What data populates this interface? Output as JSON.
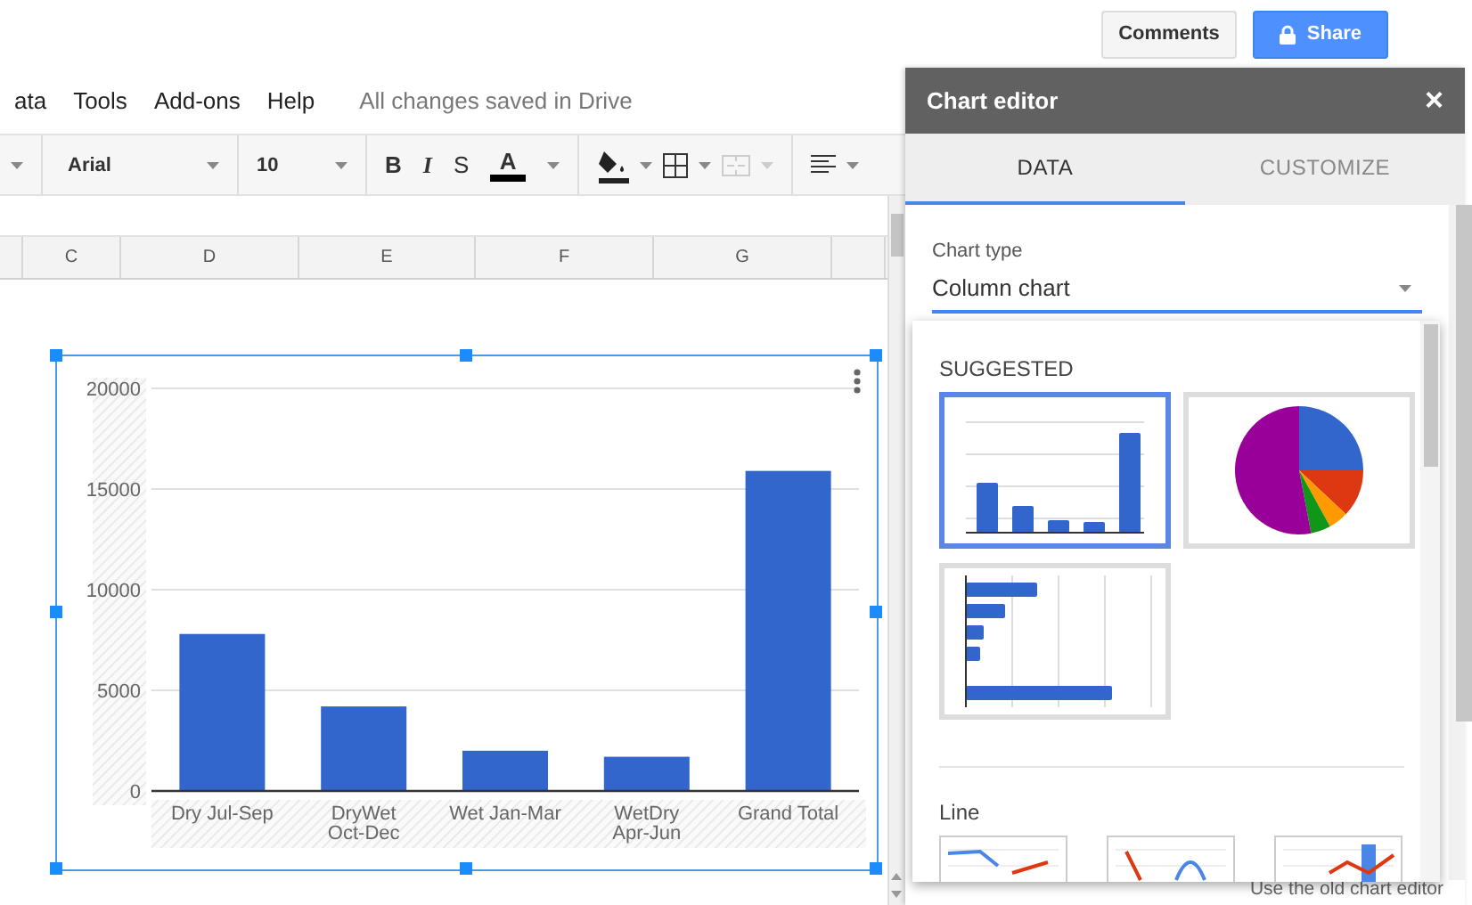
{
  "header": {
    "comments_button": "Comments",
    "share_button": "Share"
  },
  "menu": [
    {
      "label": "ata"
    },
    {
      "label": "Tools"
    },
    {
      "label": "Add-ons"
    },
    {
      "label": "Help"
    }
  ],
  "save_status": "All changes saved in Drive",
  "toolbar": {
    "font": "Arial",
    "font_size": "10",
    "format": [
      {
        "label": "B",
        "kind": "bold"
      },
      {
        "label": "I",
        "kind": "italic"
      },
      {
        "label": "S",
        "kind": "strike"
      },
      {
        "label": "A",
        "kind": "color"
      }
    ]
  },
  "columns": [
    "C",
    "D",
    "E",
    "F",
    "G"
  ],
  "chart": {
    "chart_data": {
      "type": "bar",
      "categories": [
        "Dry Jul-Sep",
        "DryWet Oct-Dec",
        "Wet Jan-Mar",
        "WetDry Apr-Jun",
        "Grand Total"
      ],
      "series": [
        {
          "color": "#3366cc",
          "values": [
            7800,
            4200,
            2000,
            1700,
            15900
          ]
        }
      ],
      "ylim": [
        0,
        20000
      ],
      "grid": true,
      "yticks": [
        0,
        5000,
        10000,
        15000,
        20000
      ]
    }
  },
  "editor": {
    "title": "Chart editor",
    "close": "×",
    "tabs": [
      {
        "label": "DATA",
        "selected": true
      },
      {
        "label": "CUSTOMIZE",
        "selected": false
      }
    ],
    "chart_type_label": "Chart type",
    "chart_type": "Column chart",
    "suggested_heading": "SUGGESTED",
    "suggested": [
      {
        "kind": "column",
        "selected": true
      },
      {
        "kind": "pie",
        "selected": false
      },
      {
        "kind": "bar",
        "selected": false
      }
    ],
    "line_heading": "Line",
    "line_options": [
      {
        "kind": "line"
      },
      {
        "kind": "smooth"
      },
      {
        "kind": "combo"
      }
    ],
    "footer_link": "Use the old chart editor"
  }
}
